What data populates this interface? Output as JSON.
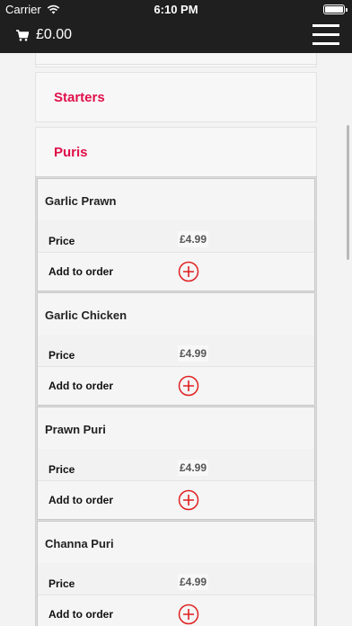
{
  "status_bar": {
    "carrier": "Carrier",
    "time": "6:10 PM"
  },
  "header": {
    "cart_total": "£0.00"
  },
  "categories": [
    {
      "label": "Starters"
    },
    {
      "label": "Puris"
    }
  ],
  "items": [
    {
      "name": "Garlic Prawn",
      "price_label": "Price",
      "price": "£4.99",
      "add_label": "Add to order"
    },
    {
      "name": "Garlic Chicken",
      "price_label": "Price",
      "price": "£4.99",
      "add_label": "Add to order"
    },
    {
      "name": "Prawn Puri",
      "price_label": "Price",
      "price": "£4.99",
      "add_label": "Add to order"
    },
    {
      "name": "Channa Puri",
      "price_label": "Price",
      "price": "£4.99",
      "add_label": "Add to order"
    }
  ],
  "colors": {
    "accent": "#e0104a",
    "add_icon": "#e02020",
    "bar": "#1f1f1f"
  },
  "icons": {
    "cart": "cart-icon",
    "menu": "hamburger-menu-icon",
    "add": "plus-circle-icon",
    "wifi": "wifi-icon",
    "battery": "battery-icon"
  }
}
